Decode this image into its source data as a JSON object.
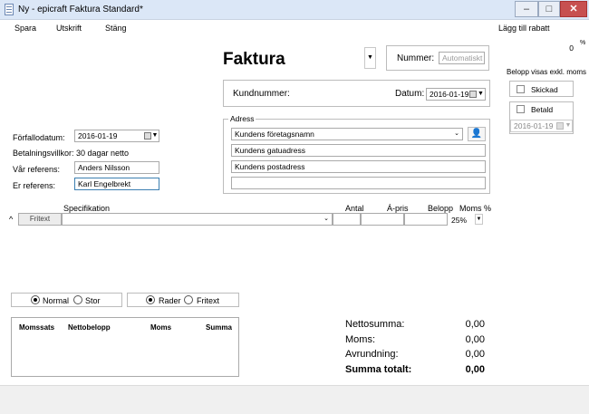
{
  "window": {
    "title": "Ny - epicraft Faktura Standard*",
    "minimize": "–",
    "maximize": "□",
    "close": "✕"
  },
  "menu": {
    "spara": "Spara",
    "utskrift": "Utskrift",
    "stang": "Stäng",
    "discount_label": "Lägg till rabatt",
    "discount_value": "0",
    "discount_unit": "%"
  },
  "header": {
    "doc_type": "Faktura",
    "number_label": "Nummer:",
    "number_placeholder": "Automatiskt",
    "customer_number_label": "Kundnummer:",
    "date_label": "Datum:",
    "date_value": "2016-01-19"
  },
  "address": {
    "group_label": "Adress",
    "company": "Kundens företagsnamn",
    "street": "Kundens gatuadress",
    "postal": "Kundens postadress",
    "extra": ""
  },
  "right_panel": {
    "vat_note": "Belopp visas exkl. moms",
    "sent_label": "Skickad",
    "paid_label": "Betald",
    "paid_date": "2016-01-19"
  },
  "left_fields": {
    "due_label": "Förfallodatum:",
    "due_value": "2016-01-19",
    "terms_label": "Betalningsvillkor:",
    "terms_value": "30 dagar netto",
    "our_ref_label": "Vår referens:",
    "our_ref_value": "Anders Nilsson",
    "your_ref_label": "Er referens:",
    "your_ref_value": "Karl Engelbrekt"
  },
  "rows": {
    "col_spec": "Specifikation",
    "col_qty": "Antal",
    "col_price": "Á-pris",
    "col_amount": "Belopp",
    "col_vat": "Moms %",
    "row_type": "Fritext",
    "row_vat": "25%",
    "caret": "^"
  },
  "options": {
    "normal": "Normal",
    "stor": "Stor",
    "rader": "Rader",
    "fritext": "Fritext"
  },
  "vat_table": {
    "col_rate": "Momssats",
    "col_net": "Nettobelopp",
    "col_vat": "Moms",
    "col_sum": "Summa"
  },
  "totals": {
    "net_label": "Nettosumma:",
    "net_value": "0,00",
    "vat_label": "Moms:",
    "vat_value": "0,00",
    "round_label": "Avrundning:",
    "round_value": "0,00",
    "total_label": "Summa totalt:",
    "total_value": "0,00"
  }
}
